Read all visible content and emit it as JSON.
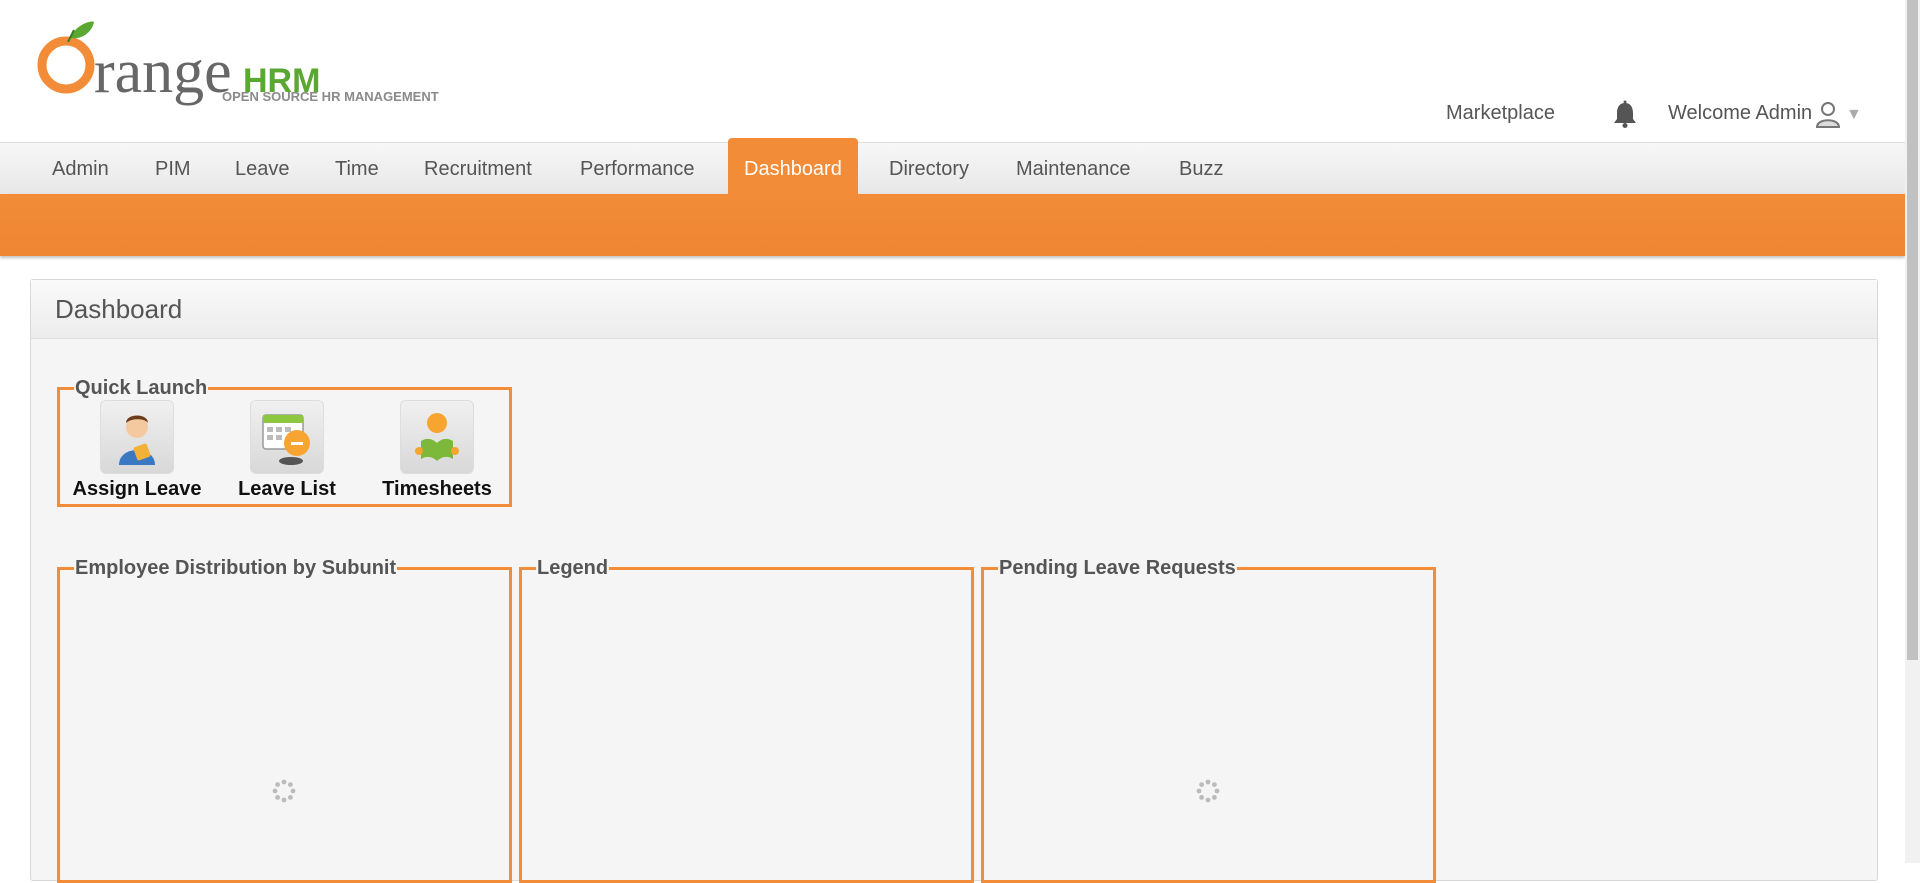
{
  "brand": {
    "logo_main": "range",
    "logo_hrm": "HRM",
    "logo_tagline": "OPEN SOURCE HR MANAGEMENT"
  },
  "header": {
    "marketplace": "Marketplace",
    "welcome": "Welcome Admin"
  },
  "nav": {
    "items": [
      {
        "label": "Admin"
      },
      {
        "label": "PIM"
      },
      {
        "label": "Leave"
      },
      {
        "label": "Time"
      },
      {
        "label": "Recruitment"
      },
      {
        "label": "Performance"
      },
      {
        "label": "Dashboard"
      },
      {
        "label": "Directory"
      },
      {
        "label": "Maintenance"
      },
      {
        "label": "Buzz"
      }
    ],
    "active": "Dashboard"
  },
  "page": {
    "title": "Dashboard"
  },
  "quick_launch": {
    "title": "Quick Launch",
    "items": [
      {
        "label": "Assign Leave",
        "icon": "assign-leave-icon"
      },
      {
        "label": "Leave List",
        "icon": "leave-list-icon"
      },
      {
        "label": "Timesheets",
        "icon": "timesheets-icon"
      }
    ]
  },
  "widgets": {
    "employee_distribution": "Employee Distribution by Subunit",
    "legend": "Legend",
    "pending_leave": "Pending Leave Requests"
  },
  "colors": {
    "accent": "#f28c38",
    "text": "#555555"
  }
}
